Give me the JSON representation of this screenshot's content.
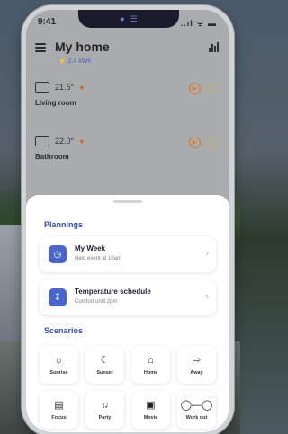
{
  "status": {
    "time": "9:41",
    "icons": "..ıl ᯤ ▬"
  },
  "header": {
    "title": "My home",
    "energy": "⚡ 2.4 kWh"
  },
  "rooms": [
    {
      "name": "Living room",
      "temp": "21.5°"
    },
    {
      "name": "Bathroom",
      "temp": "22.0°"
    }
  ],
  "plannings": {
    "title": "Plannings",
    "items": [
      {
        "title": "My Week",
        "subtitle": "Next event at 10am",
        "icon": "clock-icon"
      },
      {
        "title": "Temperature schedule",
        "subtitle": "Comfort until 2pm",
        "icon": "thermometer-icon"
      }
    ]
  },
  "scenarios": {
    "title": "Scenarios",
    "items": [
      {
        "label": "Sunrise",
        "icon": "sun-icon"
      },
      {
        "label": "Sunset",
        "icon": "moon-icon"
      },
      {
        "label": "Home",
        "icon": "home-icon"
      },
      {
        "label": "Away",
        "icon": "away-icon"
      },
      {
        "label": "Focus",
        "icon": "briefcase-icon"
      },
      {
        "label": "Party",
        "icon": "party-icon"
      },
      {
        "label": "Movie",
        "icon": "tv-icon"
      },
      {
        "label": "Work out",
        "icon": "dumbbell-icon"
      }
    ]
  },
  "colors": {
    "accent": "#3b4ea8",
    "icon_bg": "#4a66c8",
    "heat": "#d06a2a",
    "light": "#d9b42a"
  }
}
